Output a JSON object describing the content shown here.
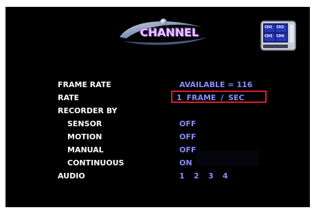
{
  "header": {
    "title": "CHANNEL",
    "monitor_channels": [
      "CH1",
      "CH2",
      "CH3",
      "CH4"
    ]
  },
  "settings": {
    "frame_rate": {
      "label": "FRAME RATE",
      "value": "AVAILABLE = 116"
    },
    "rate": {
      "label": "RATE",
      "value": "1 FRAME / SEC"
    },
    "recorder_by": {
      "label": "RECORDER BY"
    },
    "sensor": {
      "label": "SENSOR",
      "value": "OFF"
    },
    "motion": {
      "label": "MOTION",
      "value": "OFF"
    },
    "manual": {
      "label": "MANUAL",
      "value": "OFF"
    },
    "continuous": {
      "label": "CONTINUOUS",
      "value": "ON"
    },
    "audio": {
      "label": "AUDIO",
      "channels": [
        "1",
        "2",
        "3",
        "4"
      ]
    }
  },
  "colors": {
    "background": "#000000",
    "label": "#ffffff",
    "value": "#8a8cff",
    "highlight_border": "#e0202a"
  }
}
